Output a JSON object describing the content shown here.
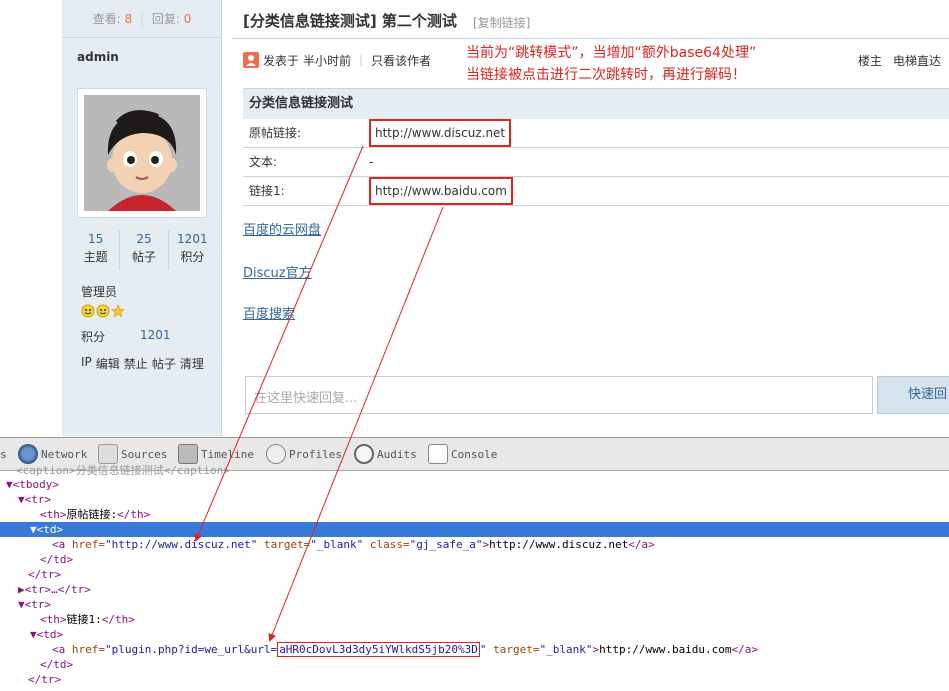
{
  "sidebar": {
    "view_label": "查看:",
    "view_count": "8",
    "reply_label": "回复:",
    "reply_count": "0",
    "username": "admin",
    "stats": [
      {
        "value": "15",
        "label": "主题"
      },
      {
        "value": "25",
        "label": "帖子"
      },
      {
        "value": "1201",
        "label": "积分"
      }
    ],
    "role": "管理员",
    "points_label": "积分",
    "points_value": "1201",
    "actions": [
      "IP",
      "编辑",
      "禁止",
      "帖子",
      "清理"
    ]
  },
  "thread": {
    "title": "[分类信息链接测试] 第二个测试",
    "copy_link": "[复制链接]",
    "posted_prefix": "发表于",
    "posted_time": "半小时前",
    "only_author": "只看该作者",
    "floor_label": "楼主",
    "elevator": "电梯直达"
  },
  "annotation": {
    "line1": "当前为“跳转模式”，当增加“额外base64处理”",
    "line2": "当链接被点击进行二次跳转时，再进行解码！"
  },
  "info_table": {
    "caption": "分类信息链接测试",
    "rows": [
      {
        "label": "原帖链接:",
        "value": "http://www.discuz.net"
      },
      {
        "label": "文本:",
        "value": "-"
      },
      {
        "label": "链接1:",
        "value": "http://www.baidu.com"
      }
    ]
  },
  "links": [
    "百度的云网盘",
    "Discuz官方",
    "百度搜索"
  ],
  "reply": {
    "placeholder": "在这里快速回复...",
    "button": "快速回"
  },
  "devtools": {
    "tabs": [
      "s",
      "Network",
      "Sources",
      "Timeline",
      "Profiles",
      "Audits",
      "Console"
    ],
    "lines": {
      "l0": "<caption>分类信息链接测试</caption>",
      "l1": "▼<tbody>",
      "l2": "▼<tr>",
      "l3_open": "<th>",
      "l3_text": "原帖链接:",
      "l3_close": "</th>",
      "l4": "▼<td>",
      "l5_pre": "<a ",
      "l5_href_name": "href=",
      "l5_href_val": "\"http://www.discuz.net\"",
      "l5_target_name": " target=",
      "l5_target_val": "\"_blank\"",
      "l5_class_name": " class=",
      "l5_class_val": "\"gj_safe_a\"",
      "l5_gt": ">",
      "l5_text": "http://www.discuz.net",
      "l5_end": "</a>",
      "l6": "</td>",
      "l7": "</tr>",
      "l8": "▶<tr>…</tr>",
      "l9": "▼<tr>",
      "l10_open": "<th>",
      "l10_text": "链接1:",
      "l10_close": "</th>",
      "l11": "▼<td>",
      "l12_pre": "<a ",
      "l12_href_name": "href=",
      "l12_href_val": "\"plugin.php?id=we_url&url=",
      "l12_href_b64": "aHR0cDovL3d3dy5iYWlkdS5jb20%3D",
      "l12_href_end": "\"",
      "l12_target_name": " target=",
      "l12_target_val": "\"_blank\"",
      "l12_gt": ">",
      "l12_text": "http://www.baidu.com",
      "l12_end": "</a>",
      "l13": "</td>",
      "l14": "</tr>"
    }
  },
  "colors": {
    "accent_red": "#e0231d",
    "link_blue": "#336699",
    "sidebar_bg": "#e5edf2",
    "selected_row": "#3879d9"
  }
}
